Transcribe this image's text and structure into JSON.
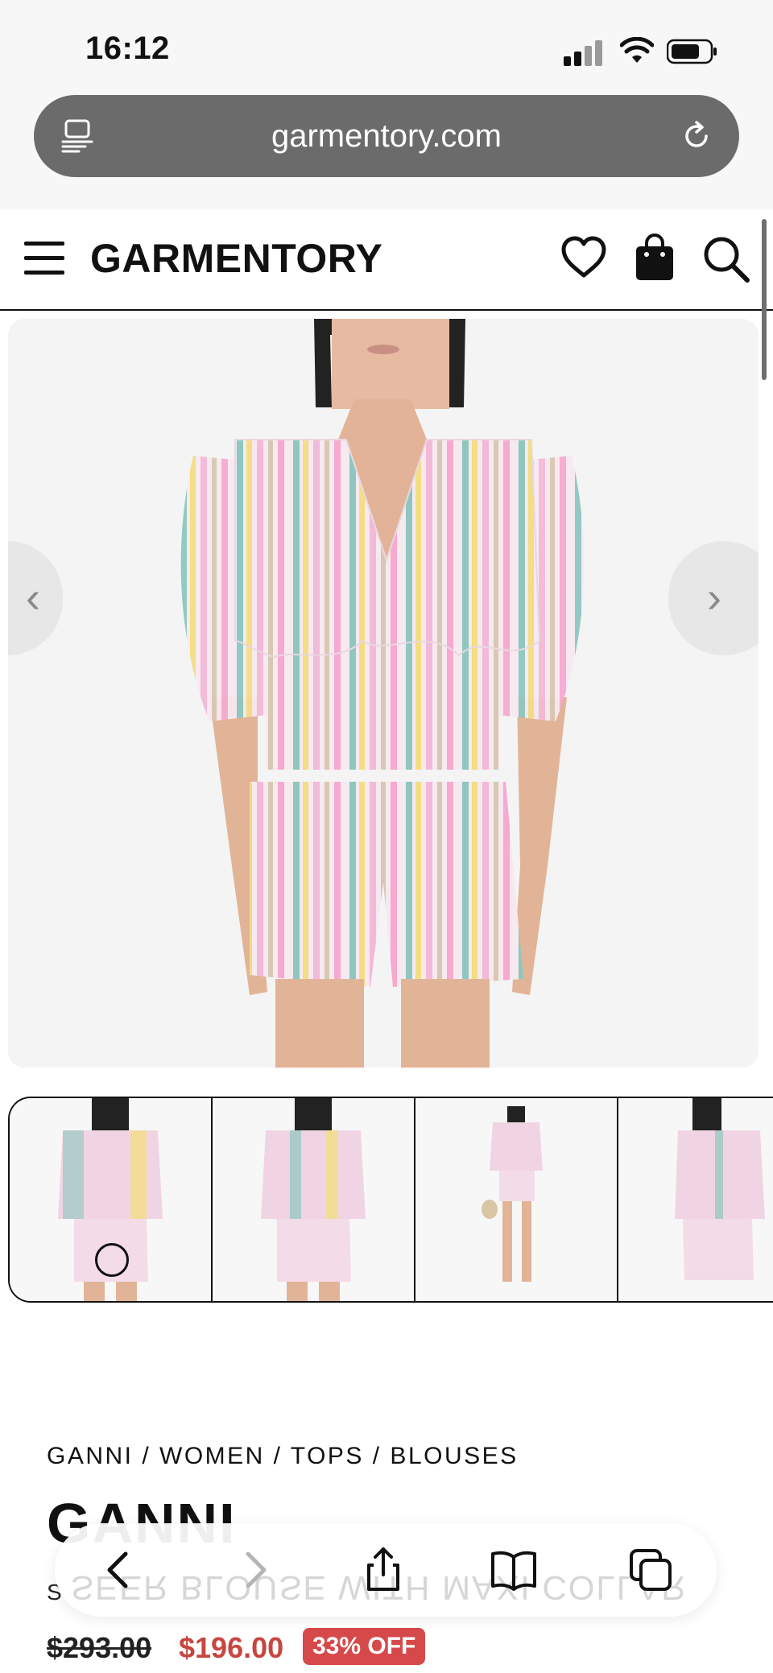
{
  "status_bar": {
    "time": "16:12"
  },
  "browser": {
    "url": "garmentory.com"
  },
  "site": {
    "logo": "GARMENTORY"
  },
  "product": {
    "breadcrumb": "GANNI / WOMEN / TOPS / BLOUSES",
    "brand": "GANNI",
    "subtitle_initial": "S",
    "obscured_text": "SEER BLOUSE WITH MAXI COLLAR - MULTI",
    "price_original": "$293.00",
    "price_sale": "$196.00",
    "discount_badge": "33% OFF"
  },
  "thumbnails": [
    "front view",
    "front view close",
    "full length view",
    "back view"
  ],
  "colors": {
    "accent_sale": "#c6473f",
    "badge_bg": "#d6494a",
    "url_bar": "#6b6b6b"
  }
}
